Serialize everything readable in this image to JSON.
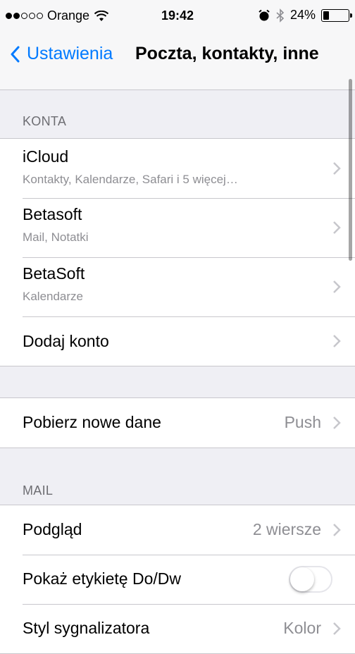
{
  "status_bar": {
    "carrier": "Orange",
    "time": "19:42",
    "battery": "24%",
    "signal_bars_filled": 2,
    "signal_bars_total": 5,
    "battery_level": 0.24
  },
  "nav": {
    "back_label": "Ustawienia",
    "title": "Poczta, kontakty, inne"
  },
  "accounts": {
    "header": "KONTA",
    "items": [
      {
        "title": "iCloud",
        "subtitle": "Kontakty, Kalendarze, Safari i 5 więcej…"
      },
      {
        "title": "Betasoft",
        "subtitle": "Mail, Notatki"
      },
      {
        "title": "BetaSoft",
        "subtitle": "Kalendarze"
      }
    ],
    "add_account": "Dodaj konto"
  },
  "fetch": {
    "title": "Pobierz nowe dane",
    "value": "Push"
  },
  "mail": {
    "header": "MAIL",
    "preview": {
      "title": "Podgląd",
      "value": "2 wiersze"
    },
    "show_to_cc": {
      "title": "Pokaż etykietę Do/Dw",
      "on": false
    },
    "flag_style": {
      "title": "Styl sygnalizatora",
      "value": "Kolor"
    }
  },
  "colors": {
    "accent": "#007aff",
    "background": "#efeff4",
    "secondary_text": "#8e8e93"
  }
}
